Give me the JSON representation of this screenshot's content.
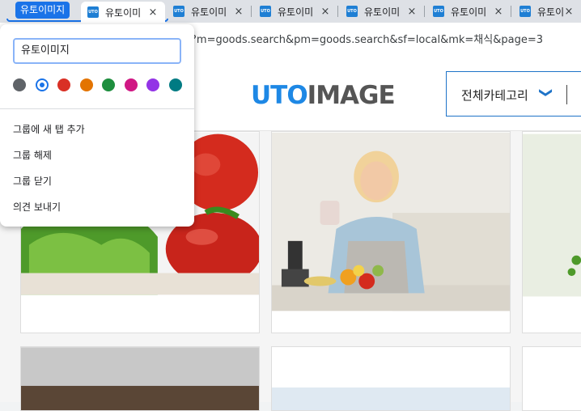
{
  "tab_group": {
    "label": "유토이미지",
    "color": "#1a73e8"
  },
  "tabs": [
    {
      "title": "유토이미",
      "favicon": "UTO",
      "close": "×"
    },
    {
      "title": "유토이미",
      "favicon": "UTO",
      "close": "×"
    },
    {
      "title": "유토이미",
      "favicon": "UTO",
      "close": "×"
    },
    {
      "title": "유토이미",
      "favicon": "UTO",
      "close": "×"
    },
    {
      "title": "유토이미",
      "favicon": "UTO",
      "close": "×"
    },
    {
      "title": "유토이미",
      "favicon": "UTO",
      "close": "×"
    }
  ],
  "address": {
    "url": "?m=goods.search&pm=goods.search&sf=local&mk=채식&page=3"
  },
  "site": {
    "logo_part1": "UTO",
    "logo_part2": "IMAGE",
    "category_label": "전체카테고리",
    "category_chevron": "❯"
  },
  "group_editor": {
    "name_value": "유토이미지",
    "colors": [
      {
        "name": "grey",
        "hex": "#5f6368"
      },
      {
        "name": "blue",
        "hex": "#1a73e8",
        "selected": true
      },
      {
        "name": "red",
        "hex": "#d93025"
      },
      {
        "name": "yellow",
        "hex": "#e37400"
      },
      {
        "name": "green",
        "hex": "#1e8e3e"
      },
      {
        "name": "pink",
        "hex": "#d01884"
      },
      {
        "name": "purple",
        "hex": "#9334e6"
      },
      {
        "name": "cyan",
        "hex": "#007b83"
      }
    ],
    "menu": [
      "그룹에 새 탭 추가",
      "그룹 해제",
      "그룹 닫기",
      "의견 보내기"
    ]
  }
}
